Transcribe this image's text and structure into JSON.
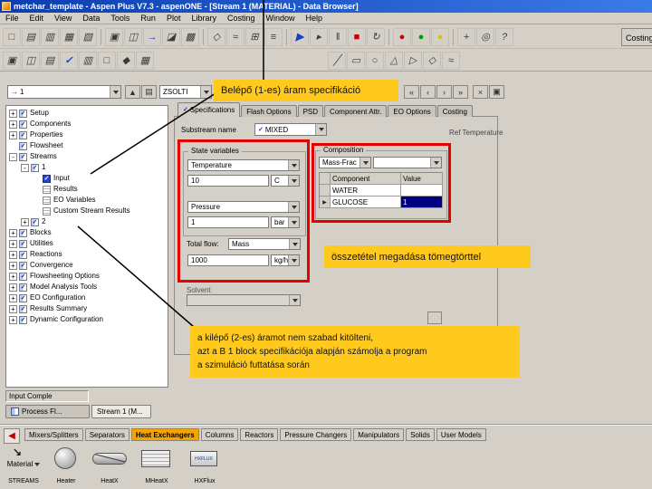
{
  "colors": {
    "titlebar_a": "#0B3DB0",
    "titlebar_b": "#3B7BE8",
    "callout_bg": "#FFC91E",
    "highlight": "#E30000",
    "palette_active": "#F6A500",
    "run_red": "#CC0000",
    "run_green": "#009900",
    "run_yellow": "#D8C400",
    "selection_blue": "#000080"
  },
  "icons": {
    "check": "✓",
    "row_marker": "▶",
    "material_arrow": "↘",
    "back_arrow": "◀",
    "combo_stream": "→",
    "up": "▲",
    "sheet": "▤",
    "nav_first": "«",
    "nav_prev": "‹",
    "nav_next": "›",
    "nav_last": "»",
    "close": "×",
    "grid": "▣",
    "hxflux_text": "HXFLUX"
  },
  "window": {
    "title": "metchar_template - Aspen Plus V7.3 - aspenONE - [Stream 1 (MATERIAL) - Data Browser]"
  },
  "menu": {
    "items": [
      "File",
      "Edit",
      "View",
      "Data",
      "Tools",
      "Run",
      "Plot",
      "Library",
      "Costing",
      "Window",
      "Help"
    ]
  },
  "toolbar1": {
    "costing_label": "Costing",
    "buttons": [
      {
        "name": "new",
        "glyph": "□"
      },
      {
        "name": "open",
        "glyph": "▤"
      },
      {
        "name": "save",
        "glyph": "▥"
      },
      {
        "name": "print",
        "glyph": "▦"
      },
      {
        "name": "print-preview",
        "glyph": "▧"
      },
      {
        "name": "copy",
        "glyph": "▣"
      },
      {
        "name": "paste",
        "glyph": "◫"
      },
      {
        "name": "next",
        "glyph": "→"
      },
      {
        "name": "data-browser",
        "glyph": "◪"
      },
      {
        "name": "control-panel",
        "glyph": "▩"
      },
      {
        "name": "flowsheet",
        "glyph": "◇"
      },
      {
        "name": "plot",
        "glyph": "≈"
      },
      {
        "name": "table",
        "glyph": "⊞"
      },
      {
        "name": "history",
        "glyph": "≡"
      },
      {
        "name": "run",
        "glyph": "▶"
      },
      {
        "name": "step",
        "glyph": "▸"
      },
      {
        "name": "pause",
        "glyph": "‖"
      },
      {
        "name": "stop",
        "glyph": "■"
      },
      {
        "name": "reinit",
        "glyph": "↻"
      },
      {
        "name": "status-red",
        "glyph": "●"
      },
      {
        "name": "status-green",
        "glyph": "●"
      },
      {
        "name": "status-yellow",
        "glyph": "●"
      },
      {
        "name": "annotate",
        "glyph": "+"
      },
      {
        "name": "zoom",
        "glyph": "◎"
      },
      {
        "name": "help",
        "glyph": "?"
      }
    ]
  },
  "toolbar2": {
    "buttons": [
      {
        "name": "variable-explorer",
        "glyph": "▣"
      },
      {
        "name": "model-summary",
        "glyph": "◫"
      },
      {
        "name": "stream-summary",
        "glyph": "▤"
      },
      {
        "name": "check-status",
        "glyph": "✓"
      },
      {
        "name": "report",
        "glyph": "▥"
      },
      {
        "name": "input-summary",
        "glyph": "□"
      },
      {
        "name": "object-manager",
        "glyph": "◆"
      },
      {
        "name": "spreadsheet",
        "glyph": "▦"
      },
      {
        "name": "draw-line",
        "glyph": "╱"
      },
      {
        "name": "draw-rect",
        "glyph": "▭"
      },
      {
        "name": "draw-circle",
        "glyph": "○"
      },
      {
        "name": "draw-triangle",
        "glyph": "△"
      },
      {
        "name": "draw-arrow",
        "glyph": "▷"
      },
      {
        "name": "draw-diamond",
        "glyph": "◇"
      },
      {
        "name": "draw-wave",
        "glyph": "≈"
      }
    ]
  },
  "browser_bar": {
    "object_value": "1",
    "units_value": "ZSOLTI"
  },
  "tabs": {
    "items": [
      "Specifications",
      "Flash Options",
      "PSD",
      "Component Attr.",
      "EO Options",
      "Costing"
    ]
  },
  "tree": {
    "items": [
      {
        "label": "Setup",
        "expand": "+"
      },
      {
        "label": "Components",
        "expand": "+"
      },
      {
        "label": "Properties",
        "expand": "+"
      },
      {
        "label": "Flowsheet",
        "expand": ""
      },
      {
        "label": "Streams",
        "expand": "-"
      },
      {
        "label": "1",
        "expand": "-"
      },
      {
        "label": "Input",
        "expand": ""
      },
      {
        "label": "Results",
        "expand": ""
      },
      {
        "label": "EO Variables",
        "expand": ""
      },
      {
        "label": "Custom Stream Results",
        "expand": ""
      },
      {
        "label": "2",
        "expand": "+"
      },
      {
        "label": "Blocks",
        "expand": "+"
      },
      {
        "label": "Utilities",
        "expand": "+"
      },
      {
        "label": "Reactions",
        "expand": "+"
      },
      {
        "label": "Convergence",
        "expand": "+"
      },
      {
        "label": "Flowsheeting Options",
        "expand": "+"
      },
      {
        "label": "Model Analysis Tools",
        "expand": "+"
      },
      {
        "label": "EO Configuration",
        "expand": "+"
      },
      {
        "label": "Results Summary",
        "expand": "+"
      },
      {
        "label": "Dynamic Configuration",
        "expand": "+"
      }
    ]
  },
  "form": {
    "substream_label": "Substream name",
    "substream_value": "MIXED",
    "ref_temperature_label": "Ref Temperature",
    "state_variables": {
      "group_label": "State variables",
      "var1_name": "Temperature",
      "var1_value": "10",
      "var1_unit": "C",
      "var2_name": "Pressure",
      "var2_value": "1",
      "var2_unit": "bar"
    },
    "total_flow": {
      "label": "Total flow:",
      "basis": "Mass",
      "value": "1000",
      "unit": "kg/hr"
    },
    "solvent_label": "Solvent",
    "composition": {
      "group_label": "Composition",
      "basis": "Mass-Frac",
      "headers": [
        "Component",
        "Value"
      ],
      "rows": [
        {
          "component": "WATER",
          "value": ""
        },
        {
          "component": "GLUCOSE",
          "value": "1"
        }
      ]
    }
  },
  "callouts": {
    "inlet": "Belépő (1-es) áram specifikáció",
    "composition": "összetétel megadása tömegtörttel",
    "outlet_line1": "a kilépő (2-es) áramot nem szabad kitölteni,",
    "outlet_line2": "azt a B 1 block specifikációja alapján számolja a program",
    "outlet_line3": "a szimuláció futtatása során"
  },
  "status": {
    "text": "Input Comple"
  },
  "bottom_tabs": {
    "tab1": "Process Fl...",
    "tab2": "Stream 1 (M..."
  },
  "palette": {
    "tabs": [
      "Mixers/Splitters",
      "Separators",
      "Heat Exchangers",
      "Columns",
      "Reactors",
      "Pressure Changers",
      "Manipulators",
      "Solids",
      "User Models"
    ],
    "material_label": "Material",
    "streams_label": "STREAMS",
    "models": [
      "Heater",
      "HeatX",
      "MHeatX",
      "HXFlux"
    ]
  }
}
